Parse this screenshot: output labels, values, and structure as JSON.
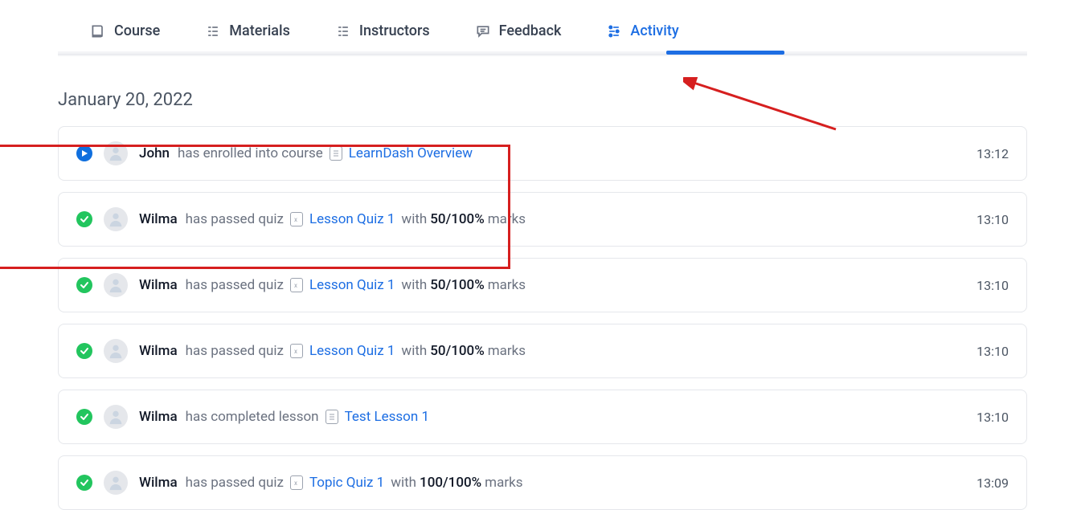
{
  "tabs": [
    {
      "label": "Course"
    },
    {
      "label": "Materials"
    },
    {
      "label": "Instructors"
    },
    {
      "label": "Feedback"
    },
    {
      "label": "Activity"
    }
  ],
  "date_header": "January 20, 2022",
  "activities": [
    {
      "status": "play",
      "user": "John",
      "action": "has enrolled into course",
      "doc_type": "course",
      "link": "LearnDash Overview",
      "with": "",
      "score": "",
      "marks": "",
      "time": "13:12"
    },
    {
      "status": "check",
      "user": "Wilma",
      "action": "has passed quiz",
      "doc_type": "quiz",
      "link": "Lesson Quiz 1",
      "with": "with",
      "score": "50/100%",
      "marks": "marks",
      "time": "13:10"
    },
    {
      "status": "check",
      "user": "Wilma",
      "action": "has passed quiz",
      "doc_type": "quiz",
      "link": "Lesson Quiz 1",
      "with": "with",
      "score": "50/100%",
      "marks": "marks",
      "time": "13:10"
    },
    {
      "status": "check",
      "user": "Wilma",
      "action": "has passed quiz",
      "doc_type": "quiz",
      "link": "Lesson Quiz 1",
      "with": "with",
      "score": "50/100%",
      "marks": "marks",
      "time": "13:10"
    },
    {
      "status": "check",
      "user": "Wilma",
      "action": "has completed lesson",
      "doc_type": "course",
      "link": "Test Lesson 1",
      "with": "",
      "score": "",
      "marks": "",
      "time": "13:10"
    },
    {
      "status": "check",
      "user": "Wilma",
      "action": "has passed quiz",
      "doc_type": "quiz",
      "link": "Topic Quiz 1",
      "with": "with",
      "score": "100/100%",
      "marks": "marks",
      "time": "13:09"
    }
  ]
}
